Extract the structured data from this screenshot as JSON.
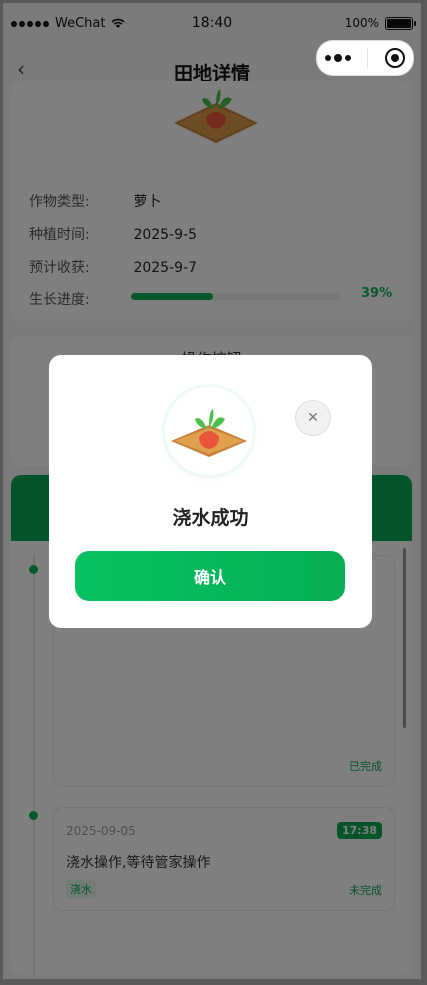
{
  "status_bar": {
    "carrier": "WeChat",
    "time": "18:40",
    "battery": "100%"
  },
  "nav": {
    "back_icon": "chevron-left-icon",
    "title": "田地详情",
    "capsule": {
      "more_icon": "more-dots-icon",
      "close_icon": "target-icon"
    }
  },
  "field_info": {
    "rows": [
      {
        "label": "作物类型:",
        "value": "萝卜"
      },
      {
        "label": "种植时间:",
        "value": "2025-9-5"
      },
      {
        "label": "预计收获:",
        "value": "2025-9-7"
      }
    ],
    "progress_label": "生长进度:",
    "progress_text": "39%",
    "progress_value": 0.39
  },
  "operations": {
    "title": "操作按钮"
  },
  "logs": [
    {
      "date": "",
      "time": "",
      "text": "",
      "tag": "",
      "status": "已完成"
    },
    {
      "date": "2025-09-05",
      "time": "17:38",
      "text": "浇水操作,等待管家操作",
      "tag": "浇水",
      "status": "未完成"
    }
  ],
  "modal": {
    "message": "浇水成功",
    "confirm_label": "确认",
    "close_icon": "close-icon"
  },
  "colors": {
    "accent": "#08a954",
    "button_gradient_start": "#08c163",
    "button_gradient_end": "#06ad55"
  }
}
